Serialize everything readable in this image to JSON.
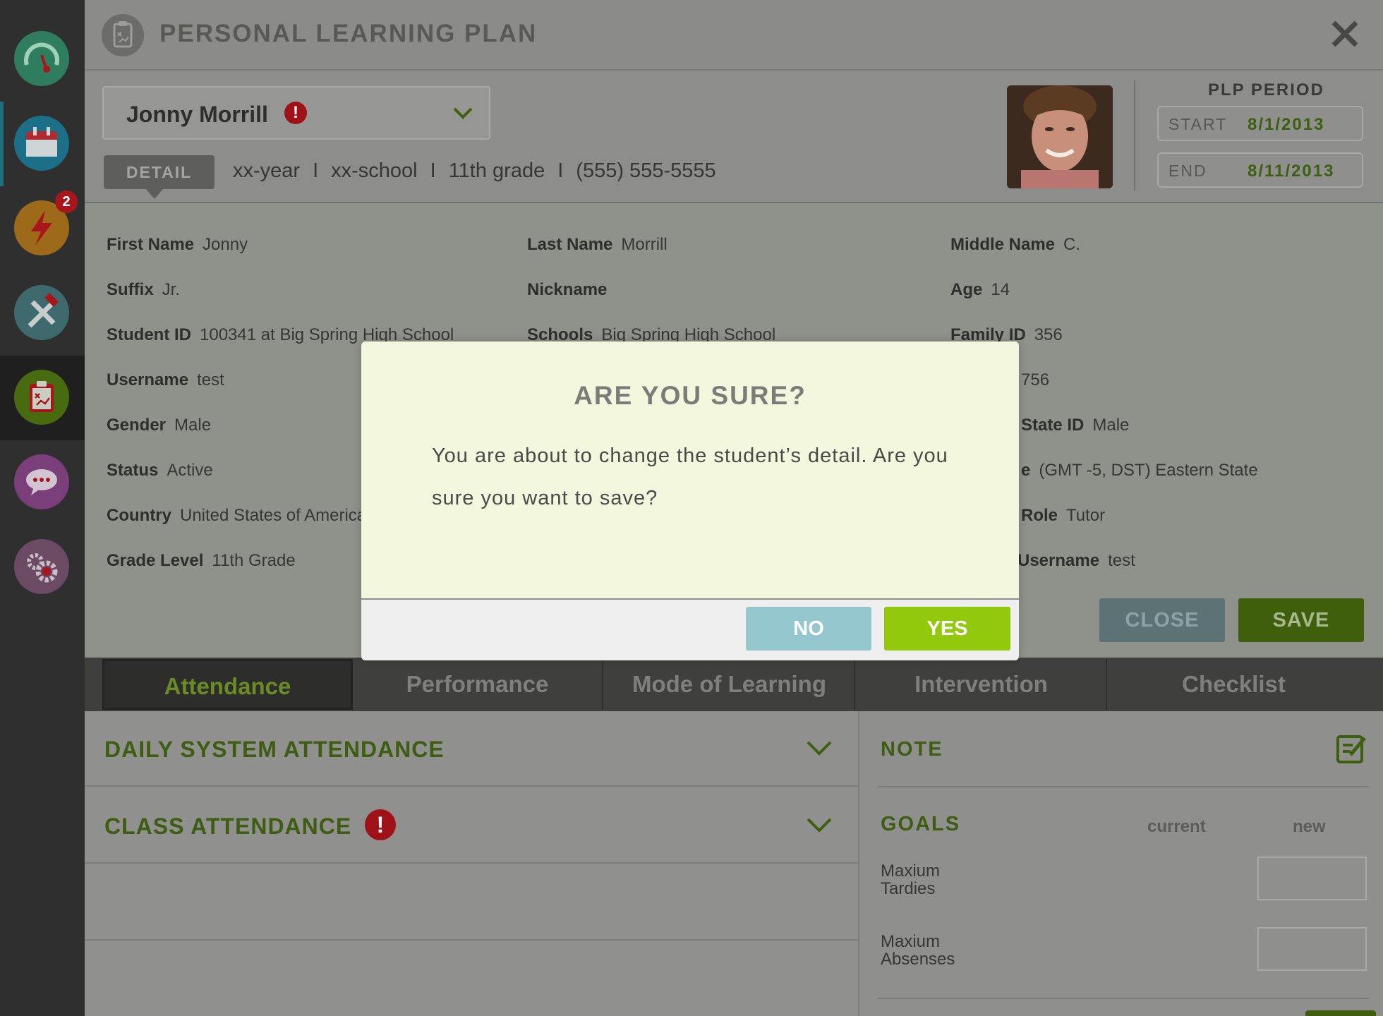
{
  "sidebar": {
    "items": [
      {
        "icon": "gauge-icon",
        "color": "#2e7d5e"
      },
      {
        "icon": "calendar-icon",
        "color": "#1b6f87"
      },
      {
        "icon": "lightning-icon",
        "color": "#9c6a18",
        "badge": "2"
      },
      {
        "icon": "tools-icon",
        "color": "#3f6a6d"
      },
      {
        "icon": "clipboard-icon",
        "color": "#486b10"
      },
      {
        "icon": "chat-icon",
        "color": "#7a3e7a"
      },
      {
        "icon": "settings-icon",
        "color": "#6b4a64"
      }
    ]
  },
  "header": {
    "title": "PERSONAL LEARNING PLAN",
    "close_icon": "close-icon"
  },
  "student": {
    "name": "Jonny Morrill",
    "alert": "!",
    "detail_tab": "DETAIL",
    "meta": {
      "year": "xx-year",
      "school": "xx-school",
      "grade": "11th grade",
      "phone": "(555) 555-5555",
      "separator": "I"
    }
  },
  "plp_period": {
    "title": "PLP PERIOD",
    "start_label": "START",
    "start_value": "8/1/2013",
    "end_label": "END",
    "end_value": "8/11/2013"
  },
  "details": {
    "col1": [
      {
        "label": "First Name",
        "value": "Jonny"
      },
      {
        "label": "Suffix",
        "value": "Jr."
      },
      {
        "label": "Student ID",
        "value": "100341 at Big Spring High School"
      },
      {
        "label": "Username",
        "value": "test"
      },
      {
        "label": "Gender",
        "value": "Male"
      },
      {
        "label": "Status",
        "value": "Active"
      },
      {
        "label": "Country",
        "value": "United States of America"
      },
      {
        "label": "Grade Level",
        "value": "11th Grade"
      }
    ],
    "col2": [
      {
        "label": "Last Name",
        "value": "Morrill"
      },
      {
        "label": "Nickname",
        "value": ""
      },
      {
        "label": "Schools",
        "value": "Big Spring High School"
      }
    ],
    "col3": [
      {
        "label": "Middle Name",
        "value": "C."
      },
      {
        "label": "Age",
        "value": "14"
      },
      {
        "label": "Family ID",
        "value": "356"
      },
      {
        "label": "",
        "value": "756"
      },
      {
        "label": "State ID",
        "value": "Male"
      },
      {
        "label": "e",
        "value": "(GMT -5, DST) Eastern State"
      },
      {
        "label": "Role",
        "value": "Tutor"
      },
      {
        "label": "Username",
        "value": "test"
      }
    ],
    "close_label": "CLOSE",
    "save_label": "SAVE"
  },
  "tabs": [
    {
      "label": "Attendance",
      "active": true
    },
    {
      "label": "Performance",
      "active": false
    },
    {
      "label": "Mode of Learning",
      "active": false
    },
    {
      "label": "Intervention",
      "active": false
    },
    {
      "label": "Checklist",
      "active": false
    }
  ],
  "attendance": {
    "daily": "DAILY SYSTEM ATTENDANCE",
    "class": "CLASS ATTENDANCE",
    "class_alert": "!"
  },
  "notes": {
    "note_title": "NOTE",
    "goals_title": "GOALS",
    "current_label": "current",
    "new_label": "new",
    "goals": [
      {
        "label": "Maxium Tardies"
      },
      {
        "label": "Maxium Absenses"
      }
    ]
  },
  "modal": {
    "title": "ARE YOU SURE?",
    "message": "You are about to change the student’s detail. Are you sure you want to save?",
    "no_label": "NO",
    "yes_label": "YES"
  }
}
